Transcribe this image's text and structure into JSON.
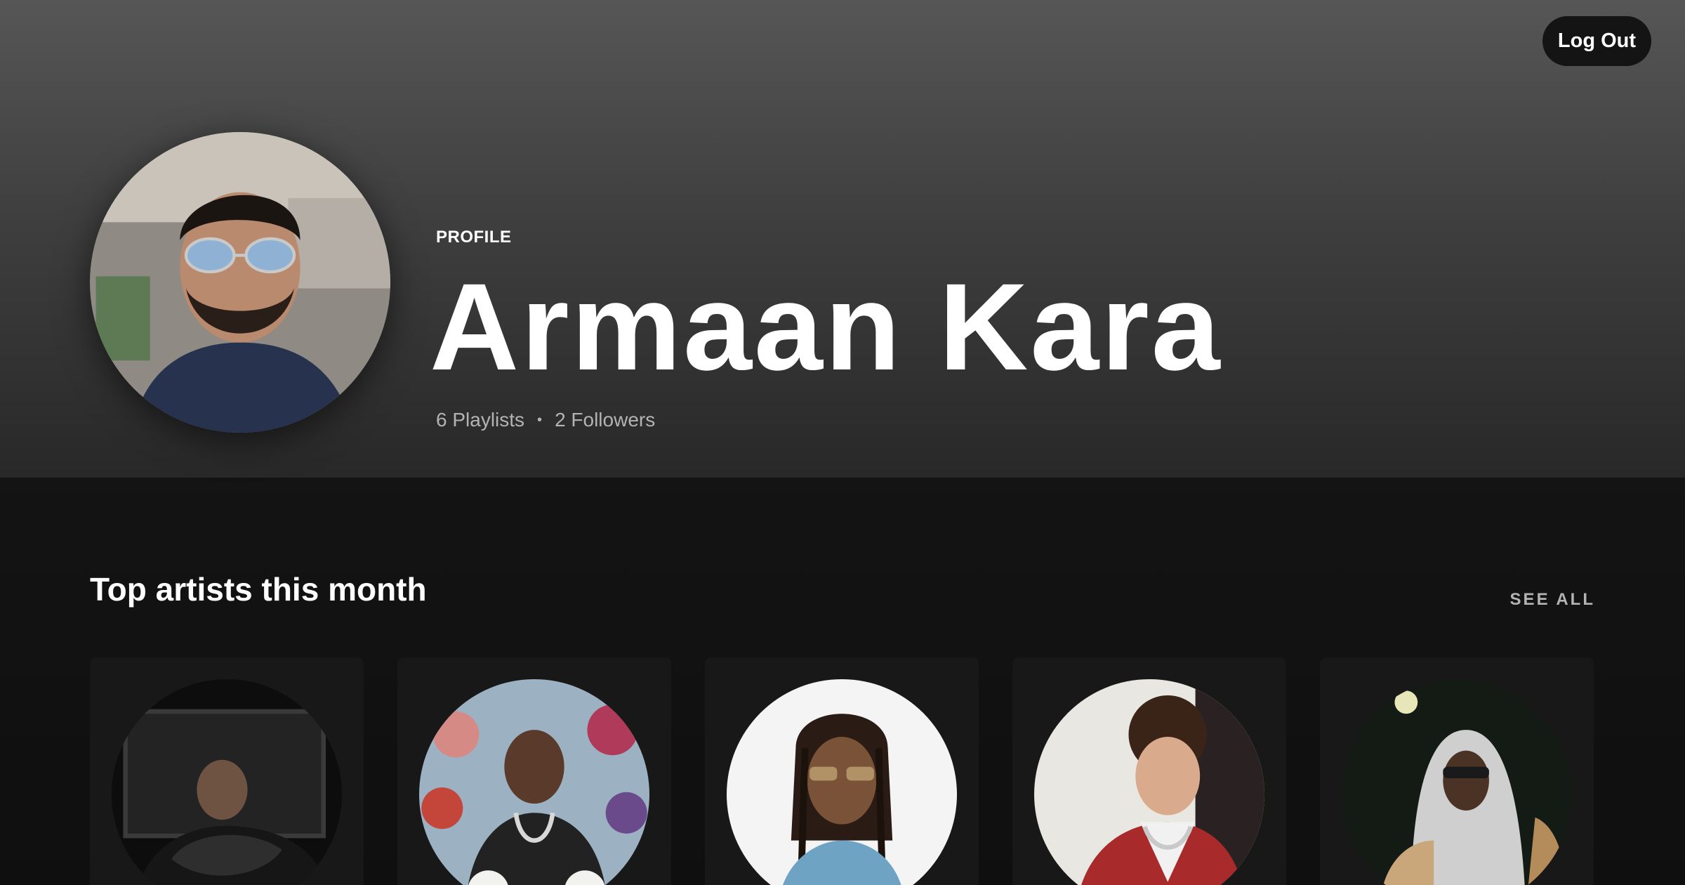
{
  "header": {
    "logout_label": "Log Out",
    "profile_label": "PROFILE",
    "user_name": "Armaan Kara",
    "stats": {
      "playlists": "6 Playlists",
      "separator": "•",
      "followers": "2 Followers"
    }
  },
  "top_artists": {
    "title": "Top artists this month",
    "see_all_label": "SEE ALL",
    "artists": [
      {
        "photo": "artist-photo-1"
      },
      {
        "photo": "artist-photo-2"
      },
      {
        "photo": "artist-photo-3"
      },
      {
        "photo": "artist-photo-4"
      },
      {
        "photo": "artist-photo-5"
      }
    ]
  },
  "colors": {
    "background": "#121212",
    "card": "#181818",
    "header_top": "#565656",
    "header_bottom": "#282828",
    "muted_text": "#b3b3b3"
  }
}
